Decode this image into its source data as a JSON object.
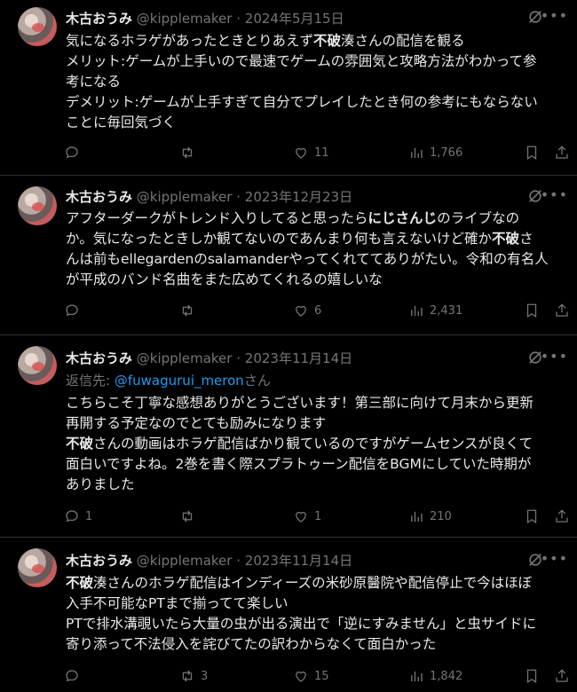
{
  "tweets": [
    {
      "name": "木古おうみ",
      "handle": "@kipplemaker",
      "date": "· 2024年5月15日",
      "reply_prefix": "",
      "reply_handle": "",
      "reply_suffix": "",
      "lines": [
        [
          "気になるホラゲがあったときとりあえず",
          "不破",
          "湊さんの配信を観る"
        ],
        [
          "メリット:ゲームが上手いので最速でゲームの雰囲気と攻略方法がわかって参",
          "",
          ""
        ],
        [
          "考になる",
          "",
          ""
        ],
        [
          "デメリット:ゲームが上手すぎて自分でプレイしたとき何の参考にもならない",
          "",
          ""
        ],
        [
          "ことに毎回気づく",
          "",
          ""
        ]
      ],
      "replies": "",
      "retweets": "",
      "likes": "11",
      "views": "1,766"
    },
    {
      "name": "木古おうみ",
      "handle": "@kipplemaker",
      "date": "· 2023年12月23日",
      "reply_prefix": "",
      "reply_handle": "",
      "reply_suffix": "",
      "lines": [
        [
          "アフターダークがトレンド入りしてると思ったら",
          "にじさんじ",
          "のライブなの"
        ],
        [
          "か。気になったときしか観てないのであんまり何も言えないけど確か",
          "不破",
          "さ"
        ],
        [
          "んは前もellegardenのsalamanderやってくれててありがたい。令和の有名人",
          "",
          ""
        ],
        [
          "が平成のバンド名曲をまた広めてくれるの嬉しいな",
          "",
          ""
        ]
      ],
      "replies": "",
      "retweets": "",
      "likes": "6",
      "views": "2,431"
    },
    {
      "name": "木古おうみ",
      "handle": "@kipplemaker",
      "date": "· 2023年11月14日",
      "reply_prefix": "返信先: ",
      "reply_handle": "@fuwagurui_meron",
      "reply_suffix": "さん",
      "lines": [
        [
          "こちらこそ丁寧な感想ありがとうございます！第三部に向けて月末から更新",
          "",
          ""
        ],
        [
          "再開する予定なのでとても励みになります",
          "",
          ""
        ],
        [
          "",
          "不破",
          "さんの動画はホラゲ配信ばかり観ているのですがゲームセンスが良くて"
        ],
        [
          "面白いですよね。2巻を書く際スプラトゥーン配信をBGMにしていた時期が",
          "",
          ""
        ],
        [
          "ありました",
          "",
          ""
        ]
      ],
      "replies": "1",
      "retweets": "",
      "likes": "1",
      "views": "210"
    },
    {
      "name": "木古おうみ",
      "handle": "@kipplemaker",
      "date": "· 2023年11月14日",
      "reply_prefix": "",
      "reply_handle": "",
      "reply_suffix": "",
      "lines": [
        [
          "",
          "不破",
          "湊さんのホラゲ配信はインディーズの米砂原醫院や配信停止で今はほぼ"
        ],
        [
          "入手不可能なPTまで揃ってて楽しい",
          "",
          ""
        ],
        [
          "PTで排水溝覗いたら大量の虫が出る演出で「逆にすみません」と虫サイドに",
          "",
          ""
        ],
        [
          "寄り添って不法侵入を詫びてたの訳わからなくて面白かった",
          "",
          ""
        ]
      ],
      "replies": "",
      "retweets": "3",
      "likes": "15",
      "views": "1,842"
    }
  ]
}
